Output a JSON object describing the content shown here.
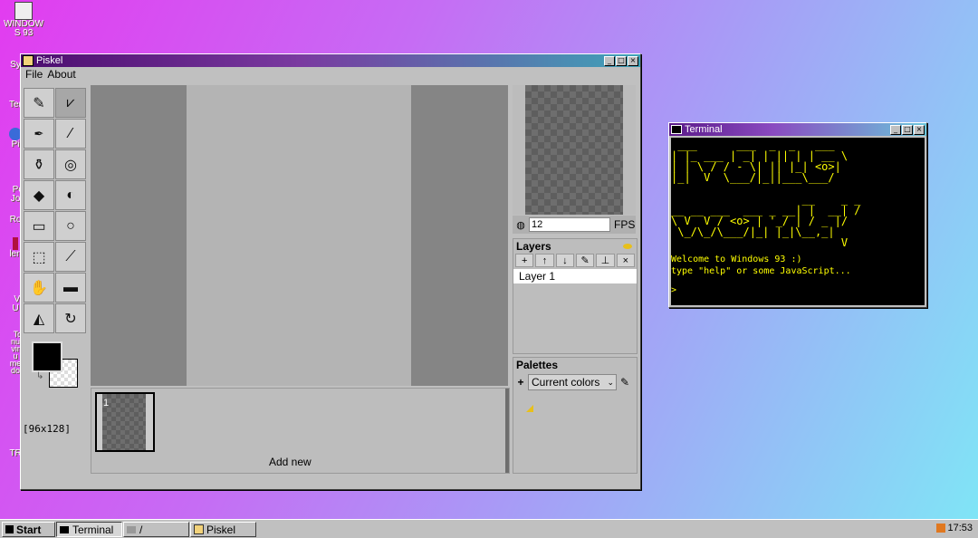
{
  "desktop": {
    "icons": [
      {
        "label": "WINDOW\nS 93"
      },
      {
        "label": "Sy"
      },
      {
        "label": "Ter"
      },
      {
        "label": "Pi"
      },
      {
        "label": "Po\nJo"
      },
      {
        "label": "Ro"
      },
      {
        "label": "len"
      },
      {
        "label": "Vi\nU"
      },
      {
        "label": "To\nnu\nvir\nu\nme\ndo"
      },
      {
        "label": "TR"
      }
    ]
  },
  "piskel": {
    "title": "Piskel",
    "menu": [
      "File",
      "About"
    ],
    "canvas_size": "[96x128]",
    "fps_value": "12",
    "fps_label": "FPS",
    "layers_title": "Layers",
    "layer_name": "Layer 1",
    "palettes_title": "Palettes",
    "palette_select": "Current colors",
    "frame_number": "1",
    "add_new_label": "Add new",
    "colors": {
      "primary": "#000000",
      "title_gradient_start": "#4b0c6e",
      "title_gradient_end": "#3ea3b8"
    }
  },
  "terminal": {
    "title": "Terminal",
    "ascii_art": " ___      ___  _  _   ___\n| |_ ___ | _| | || | | __ \\\n| | \\ / / - \\| || |_| <o>|\n|_|  V  \\___/|_||___\\___/\n\n                    __    _ _\n__ __ ___  ___ _ __| |  __| /\n\\ V  V / <o> | '_/ | / _ |/\n \\_/\\_/\\___/|_| |_|\\__,_|\n                          V",
    "welcome_line": "Welcome to Windows 93 :)",
    "help_line": "type \"help\" or some JavaScript...",
    "prompt": "> "
  },
  "taskbar": {
    "start_label": "Start",
    "items": [
      "Terminal",
      "/",
      "Piskel"
    ],
    "clock": "17:53"
  }
}
